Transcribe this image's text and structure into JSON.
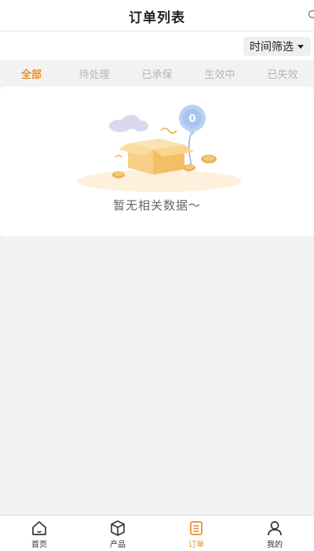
{
  "header": {
    "title": "订单列表",
    "search_icon": "search-icon"
  },
  "filter": {
    "label": "时间筛选",
    "icon": "chevron-down-icon"
  },
  "tabs": [
    {
      "label": "全部",
      "active": true
    },
    {
      "label": "待处理",
      "active": false
    },
    {
      "label": "已承保",
      "active": false
    },
    {
      "label": "生效中",
      "active": false
    },
    {
      "label": "已失效",
      "active": false
    }
  ],
  "empty_state": {
    "badge": "0",
    "message": "暂无相关数据～"
  },
  "bottom_nav": [
    {
      "label": "首页",
      "icon": "home-icon",
      "active": false
    },
    {
      "label": "产品",
      "icon": "box-icon",
      "active": false
    },
    {
      "label": "订单",
      "icon": "order-icon",
      "active": true
    },
    {
      "label": "我的",
      "icon": "user-icon",
      "active": false
    }
  ],
  "colors": {
    "accent": "#e8902a",
    "inactive_tab": "#b5b5b5",
    "background": "#f2f2f2"
  }
}
